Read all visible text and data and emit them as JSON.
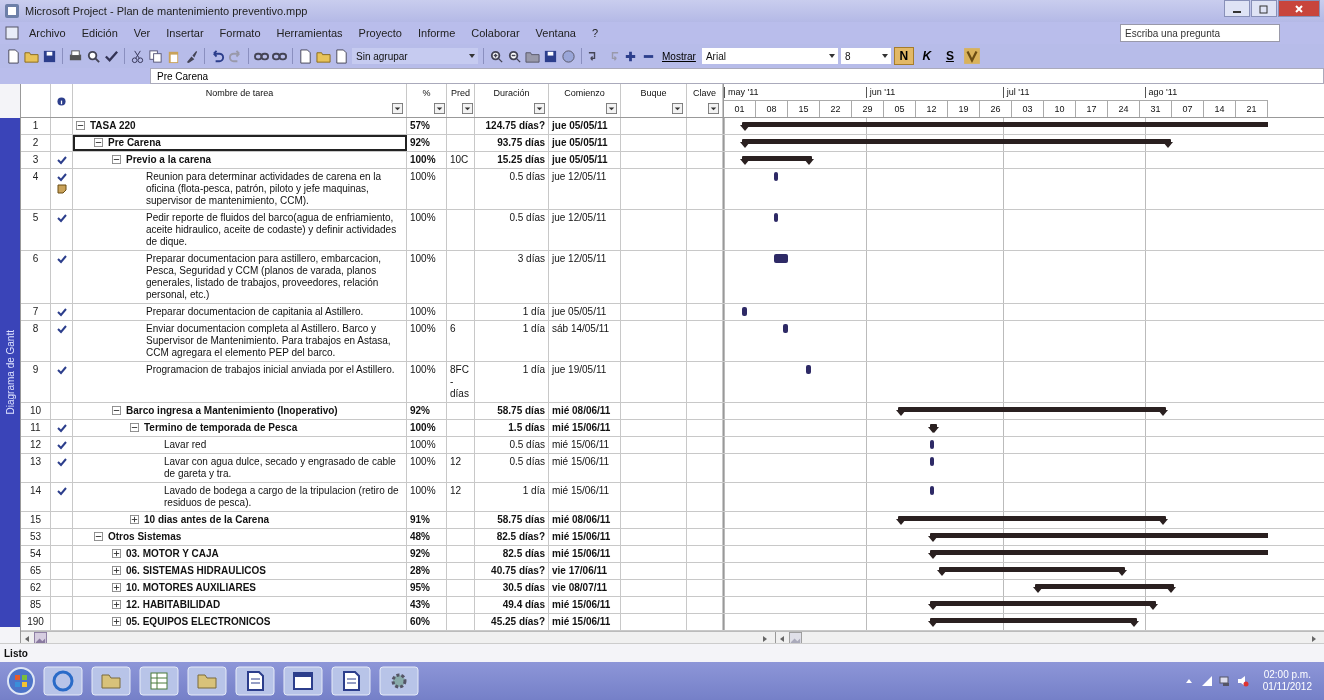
{
  "window": {
    "title": "Microsoft Project - Plan de mantenimiento preventivo.mpp"
  },
  "menu": [
    "Archivo",
    "Edición",
    "Ver",
    "Insertar",
    "Formato",
    "Herramientas",
    "Proyecto",
    "Informe",
    "Colaborar",
    "Ventana",
    "?"
  ],
  "help_search": {
    "placeholder": "Escriba una pregunta"
  },
  "toolbar": {
    "group_by": "Sin agrupar",
    "show_button": "Mostrar",
    "font": "Arial",
    "font_size": "8",
    "bold": "N",
    "italic": "K",
    "underline": "S"
  },
  "entry_bar": {
    "value": "Pre Carena"
  },
  "view_bar": {
    "label": "Diagrama de Gantt"
  },
  "table": {
    "columns": [
      "Nombre de tarea",
      "%",
      "Pred",
      "Duración",
      "Comienzo",
      "Buque",
      "Clave"
    ],
    "rows": [
      {
        "id": "1",
        "name": "TASA 220",
        "kind": "summary",
        "expanded": true,
        "done": false,
        "note": false,
        "selected": false,
        "percent": "57%",
        "duration": "124.75 días?",
        "start": "jue 05/05/11",
        "children": [
          {
            "id": "2",
            "name": "Pre Carena",
            "kind": "summary",
            "expanded": true,
            "done": false,
            "note": false,
            "selected": true,
            "percent": "92%",
            "duration": "93.75 días",
            "start": "jue 05/05/11",
            "children": [
              {
                "id": "3",
                "name": "Previo a la carena",
                "kind": "summary",
                "expanded": true,
                "done": true,
                "note": false,
                "selected": false,
                "percent": "100%",
                "pred": "10C",
                "duration": "15.25 días",
                "start": "jue 05/05/11",
                "children": [
                  {
                    "id": "4",
                    "name": "Reunion para determinar actividades de carena en la oficina (flota-pesca, patrón, piloto y jefe maquinas, supervisor de mantenimiento, CCM).",
                    "kind": "task",
                    "done": true,
                    "note": true,
                    "selected": false,
                    "percent": "100%",
                    "duration": "0.5 días",
                    "start": "jue 12/05/11"
                  },
                  {
                    "id": "5",
                    "name": "Pedir reporte de fluidos del barco(agua de enfriamiento, aceite hidraulico, aceite de codaste) y definir actividades de dique.",
                    "kind": "task",
                    "done": true,
                    "note": false,
                    "selected": false,
                    "percent": "100%",
                    "duration": "0.5 días",
                    "start": "jue 12/05/11"
                  },
                  {
                    "id": "6",
                    "name": "Preparar documentacion para astillero, embarcacion, Pesca, Seguridad y CCM (planos de varada, planos generales, listado de trabajos, proveedores, relación personal, etc.)",
                    "kind": "task",
                    "done": true,
                    "note": false,
                    "selected": false,
                    "percent": "100%",
                    "duration": "3 días",
                    "start": "jue 12/05/11"
                  },
                  {
                    "id": "7",
                    "name": "Preparar documentacion de capitania al Astillero.",
                    "kind": "task",
                    "done": true,
                    "note": false,
                    "selected": false,
                    "percent": "100%",
                    "duration": "1 día",
                    "start": "jue 05/05/11"
                  },
                  {
                    "id": "8",
                    "name": "Enviar documentacion completa al Astillero. Barco y Supervisor de Mantenimiento. Para trabajos en Astasa, CCM agregara el elemento PEP del barco.",
                    "kind": "task",
                    "done": true,
                    "note": false,
                    "selected": false,
                    "percent": "100%",
                    "pred": "6",
                    "duration": "1 día",
                    "start": "sáb 14/05/11"
                  },
                  {
                    "id": "9",
                    "name": "Programacion de trabajos inicial anviada por el Astillero.",
                    "kind": "task",
                    "done": true,
                    "note": false,
                    "selected": false,
                    "percent": "100%",
                    "pred": "8FC- días",
                    "duration": "1 día",
                    "start": "jue 19/05/11"
                  }
                ]
              },
              {
                "id": "10",
                "name": "Barco ingresa a Mantenimiento (Inoperativo)",
                "kind": "summary",
                "expanded": true,
                "done": false,
                "note": false,
                "selected": false,
                "percent": "92%",
                "duration": "58.75 días",
                "start": "mié 08/06/11",
                "children": [
                  {
                    "id": "11",
                    "name": "Termino de temporada de Pesca",
                    "kind": "summary",
                    "expanded": true,
                    "done": true,
                    "note": false,
                    "selected": false,
                    "percent": "100%",
                    "duration": "1.5 días",
                    "start": "mié 15/06/11",
                    "children": [
                      {
                        "id": "12",
                        "name": "Lavar red",
                        "kind": "task",
                        "done": true,
                        "note": false,
                        "selected": false,
                        "percent": "100%",
                        "duration": "0.5 días",
                        "start": "mié 15/06/11"
                      },
                      {
                        "id": "13",
                        "name": "Lavar con agua dulce, secado y engrasado de cable de gareta y tra.",
                        "kind": "task",
                        "done": true,
                        "note": false,
                        "selected": false,
                        "percent": "100%",
                        "pred": "12",
                        "duration": "0.5 días",
                        "start": "mié 15/06/11"
                      },
                      {
                        "id": "14",
                        "name": "Lavado de bodega a cargo de la tripulacion (retiro de residuos de pesca).",
                        "kind": "task",
                        "done": true,
                        "note": false,
                        "selected": false,
                        "percent": "100%",
                        "pred": "12",
                        "duration": "1 día",
                        "start": "mié 15/06/11"
                      }
                    ]
                  },
                  {
                    "id": "15",
                    "name": "10 dias antes de la Carena",
                    "kind": "summary",
                    "expanded": false,
                    "done": false,
                    "note": false,
                    "selected": false,
                    "percent": "91%",
                    "duration": "58.75 días",
                    "start": "mié 08/06/11"
                  }
                ]
              }
            ]
          },
          {
            "id": "53",
            "name": "Otros Sistemas",
            "kind": "summary",
            "expanded": true,
            "done": false,
            "note": false,
            "selected": false,
            "percent": "48%",
            "duration": "82.5 días?",
            "start": "mié 15/06/11",
            "children": [
              {
                "id": "54",
                "name": "03. MOTOR Y CAJA",
                "kind": "summary",
                "expanded": false,
                "done": false,
                "note": false,
                "selected": false,
                "percent": "92%",
                "duration": "82.5 días",
                "start": "mié 15/06/11"
              },
              {
                "id": "65",
                "name": "06. SISTEMAS HIDRAULICOS",
                "kind": "summary",
                "expanded": false,
                "done": false,
                "note": false,
                "selected": false,
                "percent": "28%",
                "duration": "40.75 días?",
                "start": "vie 17/06/11"
              },
              {
                "id": "62",
                "name": "10. MOTORES AUXILIARES",
                "kind": "summary",
                "expanded": false,
                "done": false,
                "note": false,
                "selected": false,
                "percent": "95%",
                "duration": "30.5 días",
                "start": "vie 08/07/11"
              },
              {
                "id": "85",
                "name": "12. HABITABILIDAD",
                "kind": "summary",
                "expanded": false,
                "done": false,
                "note": false,
                "selected": false,
                "percent": "43%",
                "duration": "49.4 días",
                "start": "mié 15/06/11"
              },
              {
                "id": "190",
                "name": "05. EQUIPOS ELECTRONICOS",
                "kind": "summary",
                "expanded": false,
                "done": false,
                "note": false,
                "selected": false,
                "percent": "60%",
                "duration": "45.25 días?",
                "start": "mié 15/06/11"
              }
            ]
          }
        ]
      }
    ]
  },
  "timescale": {
    "months": [
      "may '11",
      "jun '11",
      "jul '11",
      "ago '11"
    ],
    "weeks": [
      "01",
      "08",
      "15",
      "22",
      "29",
      "05",
      "12",
      "19",
      "26",
      "03",
      "10",
      "17",
      "24",
      "31",
      "07",
      "14",
      "21"
    ]
  },
  "status_bar": {
    "text": "Listo"
  },
  "taskbar": {
    "time": "02:00 p.m.",
    "date": "01/11/2012"
  }
}
